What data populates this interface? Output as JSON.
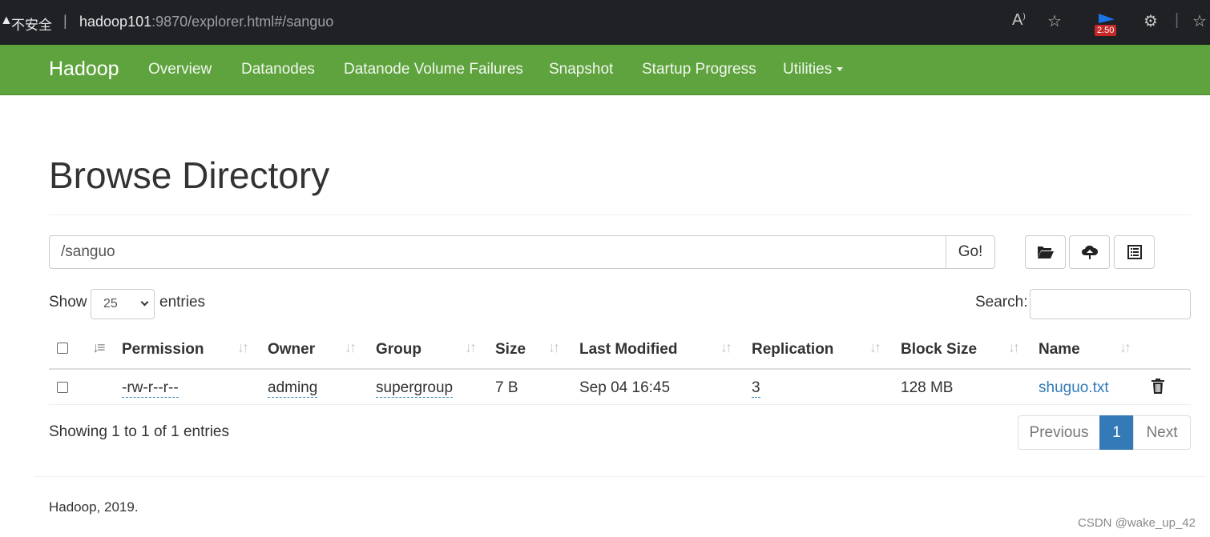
{
  "browser": {
    "insecure_label": "不安全",
    "separator": "|",
    "url_host": "hadoop101",
    "url_rest": ":9870/explorer.html#/sanguo",
    "badge": "2.50",
    "icons": [
      "read-aloud-icon",
      "favorite-add-icon",
      "extension-icon",
      "puzzle-icon",
      "favorites-icon"
    ]
  },
  "navbar": {
    "brand": "Hadoop",
    "items": [
      "Overview",
      "Datanodes",
      "Datanode Volume Failures",
      "Snapshot",
      "Startup Progress",
      "Utilities"
    ],
    "color": "#5fa33e"
  },
  "page": {
    "title": "Browse Directory",
    "path_value": "/sanguo",
    "go_label": "Go!",
    "toolbar_icons": [
      "folder-open-icon",
      "cloud-upload-icon",
      "list-icon"
    ]
  },
  "table_controls": {
    "show": "Show",
    "entries_value": "25",
    "entries": "entries",
    "search": "Search:"
  },
  "table": {
    "headers": [
      "Permission",
      "Owner",
      "Group",
      "Size",
      "Last Modified",
      "Replication",
      "Block Size",
      "Name"
    ],
    "rows": [
      {
        "permission": "-rw-r--r--",
        "owner": "adming",
        "group": "supergroup",
        "size": "7 B",
        "last_modified": "Sep 04 16:45",
        "replication": "3",
        "block_size": "128 MB",
        "name": "shuguo.txt"
      }
    ]
  },
  "pagination": {
    "info": "Showing 1 to 1 of 1 entries",
    "previous": "Previous",
    "current": "1",
    "next": "Next",
    "accent": "#337ab7"
  },
  "footer": {
    "text": "Hadoop, 2019.",
    "watermark": "CSDN @wake_up_42"
  }
}
